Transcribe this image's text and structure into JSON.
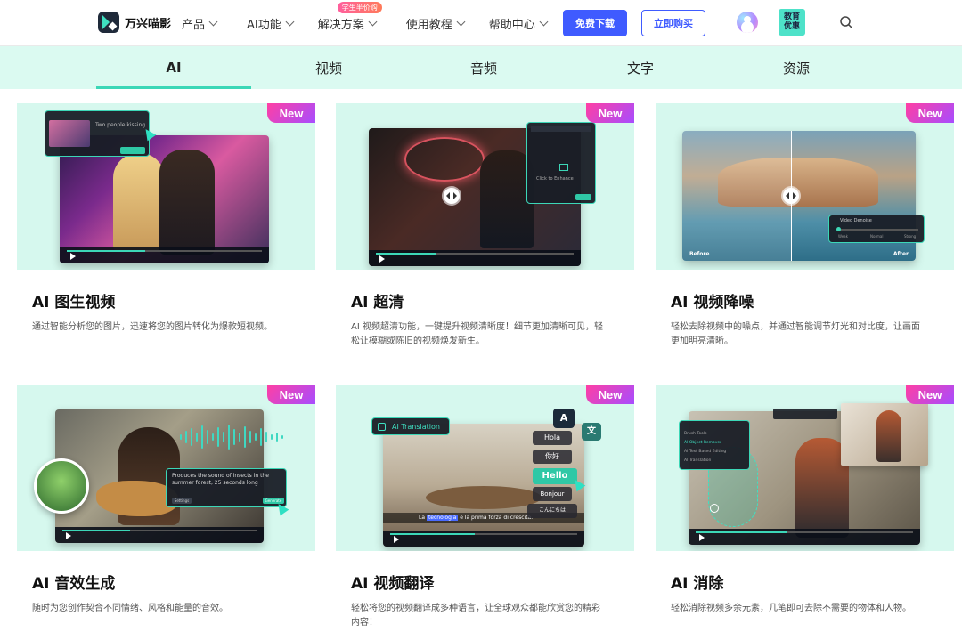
{
  "brand": {
    "name": "万兴喵影"
  },
  "nav": {
    "items": [
      {
        "label": "产品"
      },
      {
        "label": "AI功能"
      },
      {
        "label": "解决方案",
        "badge": "学生半价购"
      },
      {
        "label": "使用教程"
      },
      {
        "label": "帮助中心"
      }
    ],
    "download_label": "免费下载",
    "buy_label": "立即购买",
    "edu_line1": "教育",
    "edu_line2": "优惠"
  },
  "tabs": [
    {
      "label": "AI",
      "active": true
    },
    {
      "label": "视频",
      "active": false
    },
    {
      "label": "音频",
      "active": false
    },
    {
      "label": "文字",
      "active": false
    },
    {
      "label": "资源",
      "active": false
    }
  ],
  "badge_new": "New",
  "cards": [
    {
      "title": "AI 图生视频",
      "desc": "通过智能分析您的图片，迅速将您的图片转化为爆款短视频。",
      "panel_text": "Two people kissing"
    },
    {
      "title": "AI 超清",
      "desc": "AI 视频超清功能，一键提升视频清晰度！细节更加清晰可见，轻松让模糊或陈旧的视频焕发新生。",
      "panel_text": "Click to Enhance"
    },
    {
      "title": "AI 视频降噪",
      "desc": "轻松去除视频中的噪点，并通过智能调节灯光和对比度，让画面更加明亮清晰。",
      "panel_text": "Video Denoise",
      "before_label": "Before",
      "after_label": "After",
      "levels": [
        "Weak",
        "Normal",
        "Strong"
      ]
    },
    {
      "title": "AI 音效生成",
      "desc": "随时为您创作契合不同情绪、风格和能量的音效。",
      "panel_text": "Produces the sound of insects in the summer forest, 25 seconds long",
      "settings_label": "Settings",
      "generate_label": "Generate"
    },
    {
      "title": "AI 视频翻译",
      "desc": "轻松将您的视频翻译成多种语言，让全球观众都能欣赏您的精彩内容！",
      "panel_text": "AI Translation",
      "words": [
        "Hola",
        "你好",
        "Hello",
        "Bonjour",
        "こんにちは"
      ],
      "subtitle_hl": "tecnologia",
      "subtitle_pre": "La",
      "subtitle_post": "è la prima forza di crescita."
    },
    {
      "title": "AI 消除",
      "desc": "轻松消除视频多余元素，几笔即可去除不需要的物体和人物。",
      "panel_items": [
        "Brush Tools",
        "AI Object Remover",
        "AI Text Based Editing",
        "AI Translation"
      ]
    }
  ]
}
